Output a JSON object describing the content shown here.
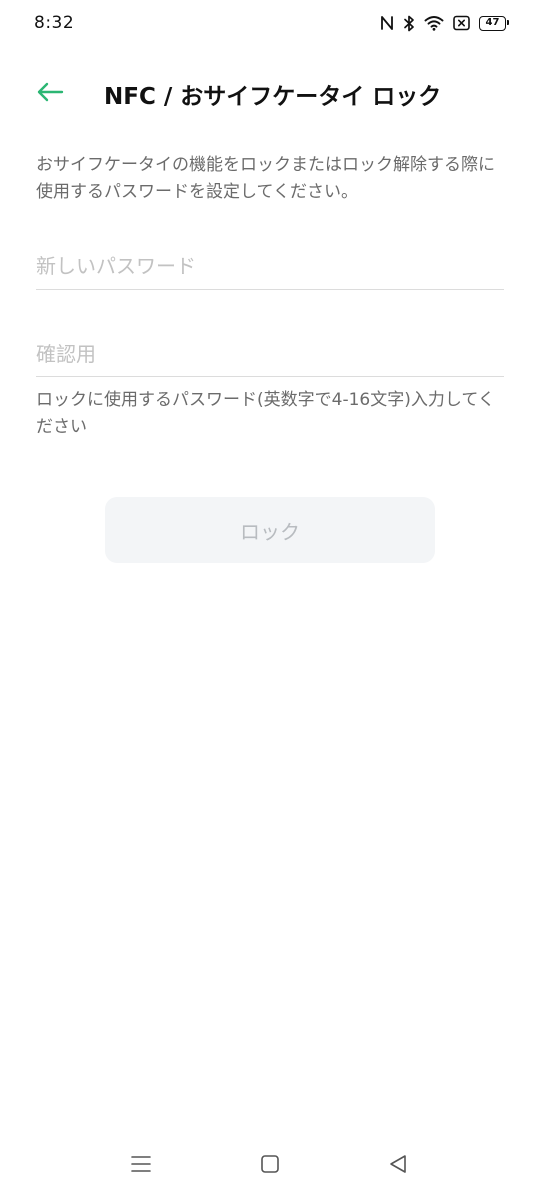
{
  "status_bar": {
    "time": "8:32",
    "battery": "47",
    "icons": [
      "nfc-icon",
      "bluetooth-icon",
      "wifi-icon",
      "no-sim-icon",
      "battery-icon"
    ]
  },
  "header": {
    "back_icon": "arrow-left-icon",
    "title": "NFC / おサイフケータイ ロック"
  },
  "description": "おサイフケータイの機能をロックまたはロック解除する際に使用するパスワードを設定してください。",
  "form": {
    "new_password": {
      "value": "",
      "placeholder": "新しいパスワード"
    },
    "confirm_password": {
      "value": "",
      "placeholder": "確認用"
    },
    "hint": "ロックに使用するパスワード(英数字で4-16文字)入力してください"
  },
  "lock_button": {
    "label": "ロック"
  },
  "nav_bar": {
    "icons": [
      "menu-icon",
      "home-icon",
      "back-triangle-icon"
    ]
  },
  "colors": {
    "accent": "#2bb673",
    "disabled_text": "#b8bcc0",
    "disabled_bg": "#f3f5f7",
    "secondary_text": "#6b6b6b"
  }
}
